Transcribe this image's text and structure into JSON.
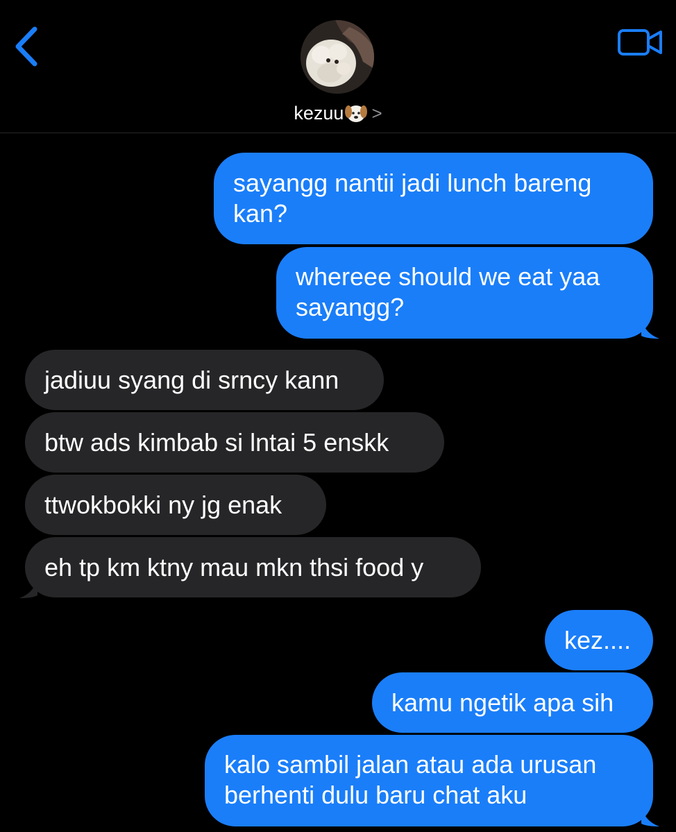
{
  "header": {
    "back_icon": "chevron-left-icon",
    "video_icon": "video-camera-icon",
    "contact_name": "kezuu",
    "contact_emoji": "dog-face-icon",
    "chevron": ">"
  },
  "messages": [
    {
      "direction": "outgoing",
      "text": "sayangg nantii jadi lunch bareng\nkan?"
    },
    {
      "direction": "outgoing",
      "text": "whereee should we eat yaa\nsayangg?"
    },
    {
      "direction": "incoming",
      "text": "jadiuu syang di srncy kann"
    },
    {
      "direction": "incoming",
      "text": "btw ads kimbab si lntai 5 enskk"
    },
    {
      "direction": "incoming",
      "text": "ttwokbokki ny jg enak"
    },
    {
      "direction": "incoming",
      "text": "eh tp km ktny mau mkn thsi food y"
    },
    {
      "direction": "outgoing",
      "text": "kez...."
    },
    {
      "direction": "outgoing",
      "text": "kamu ngetik apa sih"
    },
    {
      "direction": "outgoing",
      "text": "kalo sambil jalan atau ada urusan\nberhenti dulu baru chat aku"
    }
  ],
  "colors": {
    "background": "#000000",
    "outgoing_bubble": "#1a7ef9",
    "incoming_bubble": "#262628",
    "accent": "#1a7ef9"
  }
}
